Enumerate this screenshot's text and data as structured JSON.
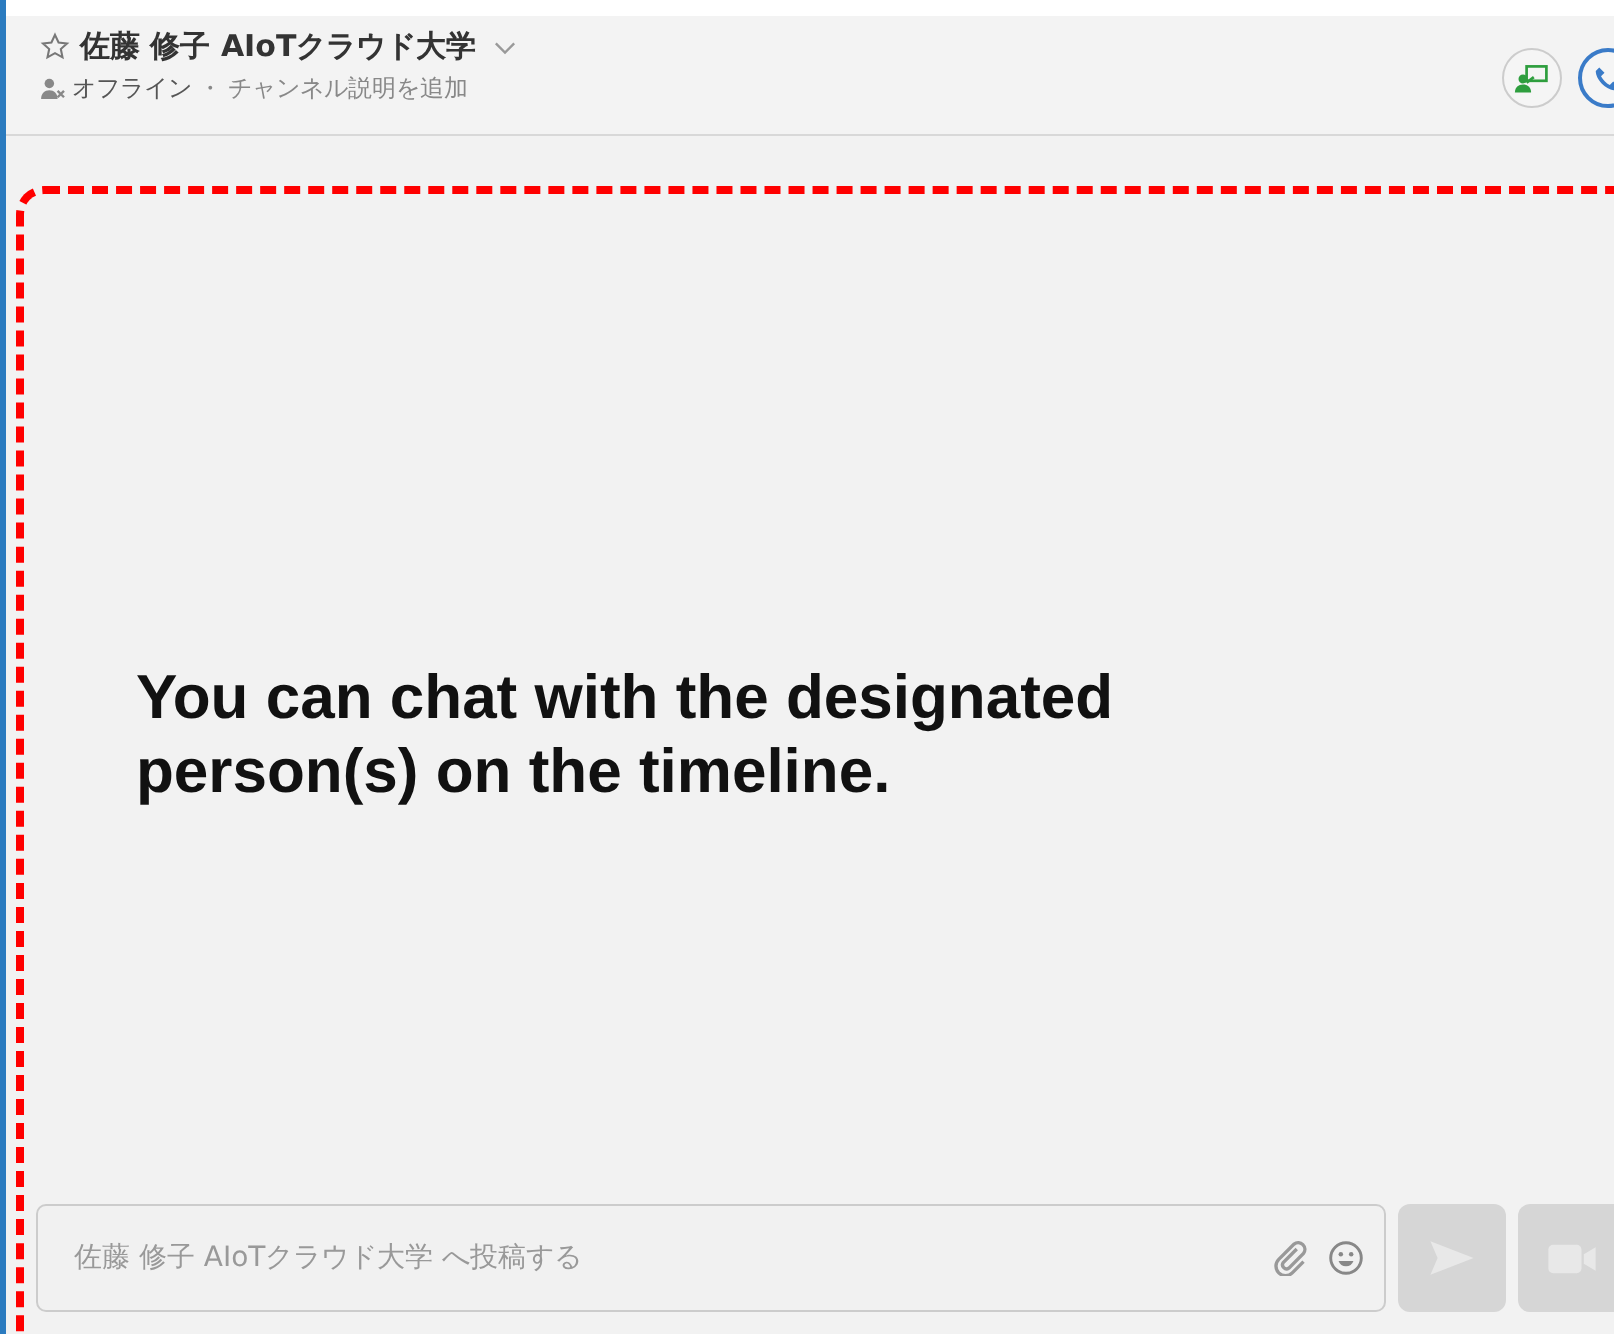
{
  "header": {
    "title": "佐藤 修子 AIoTクラウド大学",
    "status": "オフライン",
    "separator": "・",
    "description_link": "チャンネル説明を追加"
  },
  "annotation": {
    "text": "You can chat with the designated person(s) on the timeline."
  },
  "composer": {
    "placeholder": "佐藤 修子 AIoTクラウド大学 へ投稿する"
  }
}
